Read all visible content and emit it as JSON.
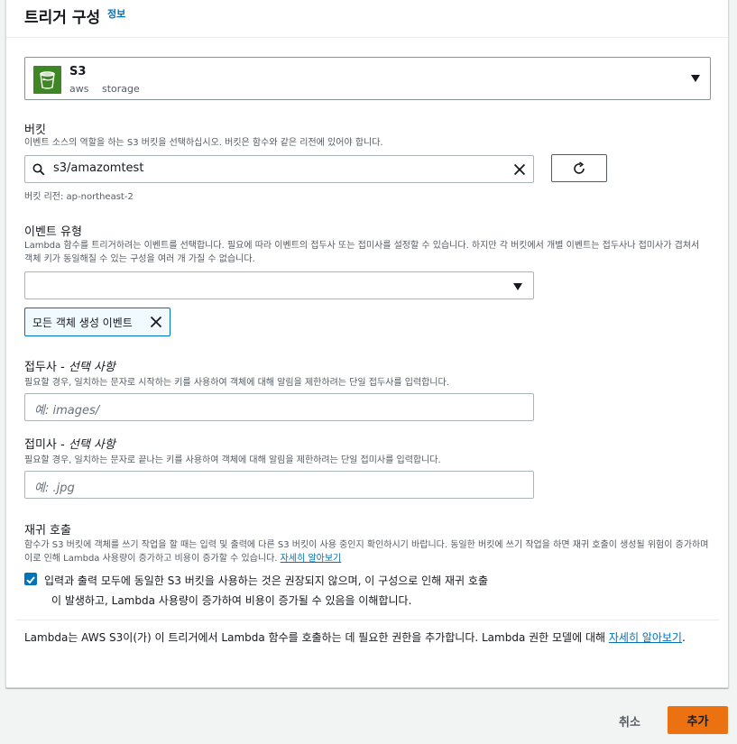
{
  "header": {
    "title": "트리거 구성",
    "info_link": "정보"
  },
  "source": {
    "name": "S3",
    "tags": [
      "aws",
      "storage"
    ],
    "icon": "s3-bucket-icon"
  },
  "bucket": {
    "label": "버킷",
    "description": "이벤트 소스의 역할을 하는 S3 버킷을 선택하십시오. 버킷은 함수와 같은 리전에 있어야 합니다.",
    "value": "s3/amazomtest",
    "region_note": "버킷 리전: ap-northeast-2"
  },
  "event_type": {
    "label": "이벤트 유형",
    "description": "Lambda 함수를 트리거하려는 이벤트를 선택합니다. 필요에 따라 이벤트의 접두사 또는 접미사를 설정할 수 있습니다. 하지만 각 버킷에서 개별 이벤트는 접두사나 접미사가 겹쳐서 객체 키가 동일해질 수 있는 구성을 여러 개 가질 수 없습니다.",
    "selected_value": "",
    "tokens": [
      "모든 객체 생성 이벤트"
    ]
  },
  "prefix": {
    "label": "접두사",
    "optional": "- 선택 사항",
    "description": "필요할 경우, 일치하는 문자로 시작하는 키를 사용하여 객체에 대해 알림을 제한하려는 단일 접두사를 입력합니다.",
    "placeholder": "예: images/"
  },
  "suffix": {
    "label": "접미사",
    "optional": "- 선택 사항",
    "description": "필요할 경우, 일치하는 문자로 끝나는 키를 사용하여 객체에 대해 알림을 제한하려는 단일 접미사를 입력합니다.",
    "placeholder": "예: .jpg"
  },
  "recursive": {
    "label": "재귀 호출",
    "description": "함수가 S3 버킷에 객체를 쓰기 작업을 할 때는 입력 및 출력에 다른 S3 버킷이 사용 중인지 확인하시기 바랍니다. 동일한 버킷에 쓰기 작업을 하면 재귀 호출이 생성될 위험이 증가하며 이로 인해 Lambda 사용량이 증가하고 비용이 증가할 수 있습니다.",
    "learn_more": "자세히 알아보기",
    "ack_line1": "입력과 출력 모두에 동일한 S3 버킷을 사용하는 것은 권장되지 않으며, 이 구성으로 인해 재귀 호출",
    "ack_line2": "이 발생하고, Lambda 사용량이 증가하여 비용이 증가될 수 있음을 이해합니다.",
    "checked": true
  },
  "permission_note": {
    "text": "Lambda는 AWS S3이(가) 이 트리거에서 Lambda 함수를 호출하는 데 필요한 권한을 추가합니다. Lambda 권한 모델에 대해 ",
    "link": "자세히 알아보기",
    "suffix": "."
  },
  "actions": {
    "cancel": "취소",
    "add": "추가"
  },
  "colors": {
    "accent": "#0073bb",
    "primary_button": "#ec7211",
    "s3_icon": "#3f8624"
  }
}
